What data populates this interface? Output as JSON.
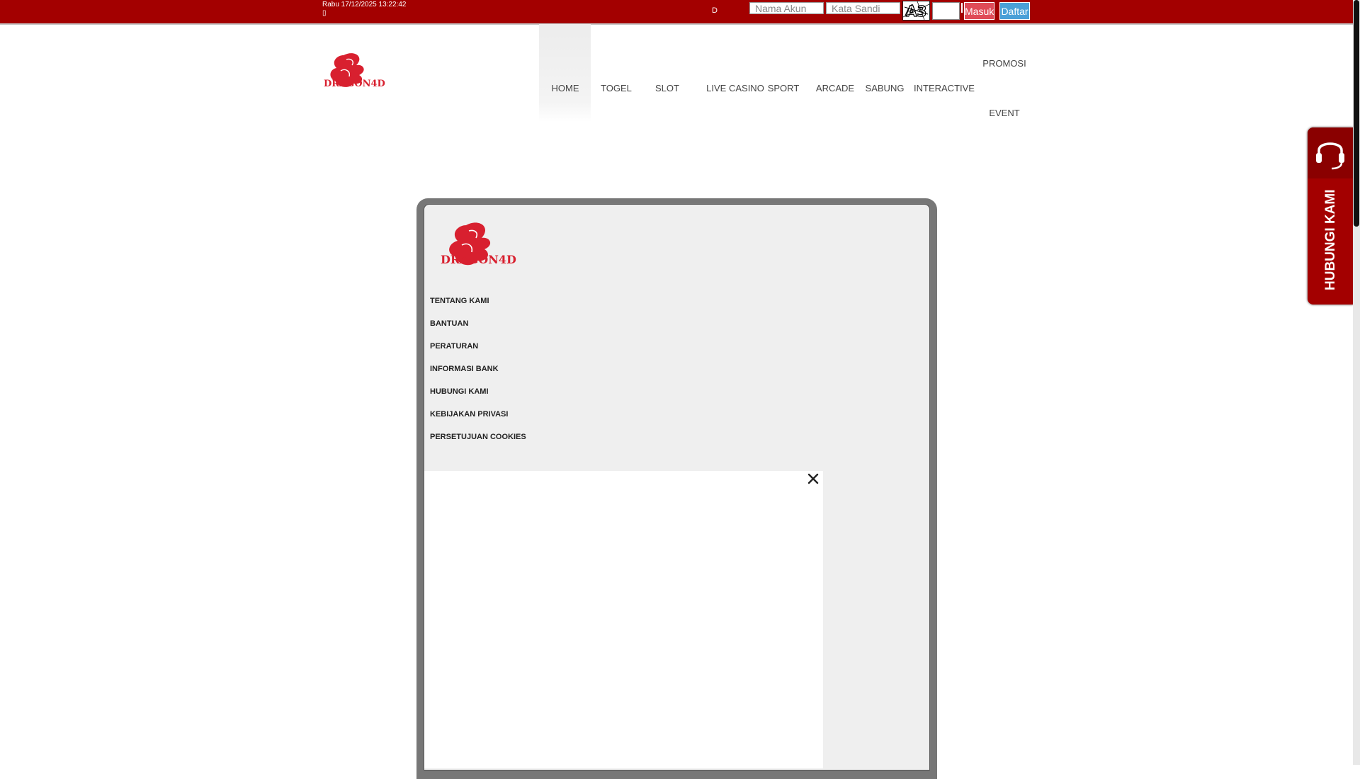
{
  "topbar": {
    "datetime": "Rabu 17/12/2025 13:22:42",
    "dot": "▯",
    "lang": "D",
    "username_placeholder": "Nama Akun",
    "password_placeholder": "Kata Sandi",
    "captcha_text": "A3",
    "login_label": "Masuk",
    "register_label": "Daftar",
    "bg_color": "#a30000"
  },
  "brand": {
    "logo_text": "DRAGON4D"
  },
  "nav": {
    "items": [
      "HOME",
      "TOGEL",
      "SLOT",
      "LIVE CASINO",
      "SPORT",
      "ARCADE",
      "SABUNG",
      "INTERACTIVE",
      "PROMOSI",
      "EVENT"
    ]
  },
  "modal": {
    "menu": [
      "TENTANG KAMI",
      "BANTUAN",
      "PERATURAN",
      "INFORMASI BANK",
      "HUBUNGI KAMI",
      "KEBIJAKAN PRIVASI",
      "PERSETUJUAN COOKIES"
    ]
  },
  "side_widget": {
    "label": "HUBUNGI KAMI",
    "icon": "headset-icon"
  }
}
